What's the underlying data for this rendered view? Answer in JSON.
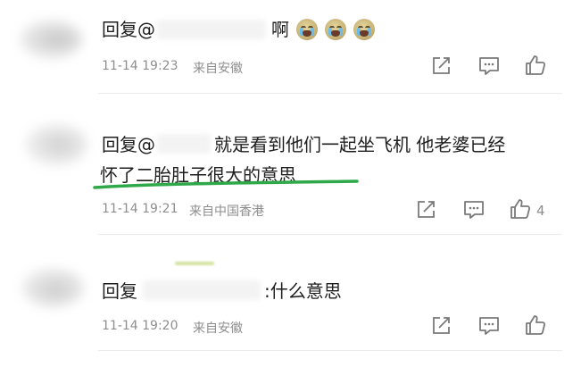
{
  "comments": [
    {
      "reply_prefix": "回复@",
      "text_tail": "啊",
      "emojis": [
        "cry-emoji",
        "cry-emoji",
        "cry-emoji"
      ],
      "timestamp": "11-14 19:23",
      "source": "来自安徽"
    },
    {
      "reply_prefix": "回复@",
      "text_line1": "就是看到他们一起坐飞机 他老婆已经",
      "text_line2": "怀了二胎肚子很大的意思",
      "timestamp": "11-14 19:21",
      "source": "来自中国香港",
      "like_count": "4"
    },
    {
      "reply_prefix": "回复",
      "text_tail": ":什么意思",
      "timestamp": "11-14 19:20",
      "source": "来自安徽"
    }
  ],
  "colors": {
    "highlight_underline": "#2fa84a",
    "meta_text": "#8e8e8e",
    "icon": "#7a7a7a"
  }
}
